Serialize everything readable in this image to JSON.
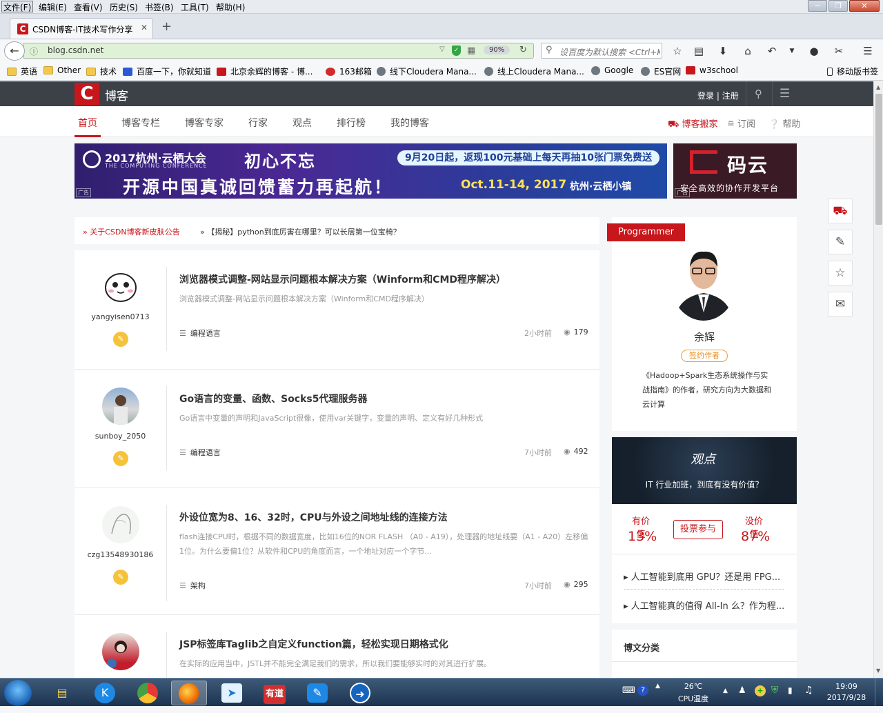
{
  "menubar": {
    "items": [
      "文件(F)",
      "编辑(E)",
      "查看(V)",
      "历史(S)",
      "书签(B)",
      "工具(T)",
      "帮助(H)"
    ]
  },
  "tab": {
    "title": "CSDN博客-IT技术写作分享",
    "favicon": "C"
  },
  "address": {
    "url": "blog.csdn.net",
    "zoom": "90%",
    "search_placeholder": "设百度为默认搜索 <Ctrl+K"
  },
  "bookmarks": [
    "英语",
    "Other",
    "技术",
    "百度一下，你就知道",
    "北京余辉的博客 - 博...",
    "163邮箱",
    "线下Cloudera Mana...",
    "线上Cloudera Mana...",
    "Google",
    "ES官网",
    "w3school",
    "移动版书签"
  ],
  "header": {
    "logo": "C",
    "brand": "博客",
    "login": "登录 | 注册"
  },
  "subnav": {
    "items": [
      "首页",
      "博客专栏",
      "博客专家",
      "行家",
      "观点",
      "排行榜",
      "我的博客"
    ],
    "right": [
      "博客搬家",
      "订阅",
      "帮助"
    ]
  },
  "banner1": {
    "event": "2017杭州·云栖大会",
    "event_en": "THE COMPUTING CONFERENCE",
    "slogan1": "初心不忘",
    "promo": "9月20日起，返现100元基础上每天再抽10张门票免费送",
    "slogan2": "开源中国真诚回馈蓄力再起航！",
    "dates": "Oct.11-14, 2017",
    "place": "杭州·云栖小镇",
    "ad": "广告"
  },
  "banner2": {
    "name": "码云",
    "slogan": "安全高效的协作开发平台",
    "ad": "广告"
  },
  "notices": [
    "» 关于CSDN博客新皮肤公告",
    "» 【揭秘】python到底厉害在哪里？可以长居第一位宝椅？"
  ],
  "articles": [
    {
      "user": "yangyisen0713",
      "title": "浏览器模式调整-网站显示问题根本解决方案（Winform和CMD程序解决）",
      "desc": "浏览器模式调整-网站显示问题根本解决方案（Winform和CMD程序解决）",
      "category": "编程语言",
      "time": "2小时前",
      "views": "179"
    },
    {
      "user": "sunboy_2050",
      "title": "Go语言的变量、函数、Socks5代理服务器",
      "desc": "Go语言中变量的声明和JavaScript很像，使用var关键字，变量的声明、定义有好几种形式",
      "category": "编程语言",
      "time": "7小时前",
      "views": "492"
    },
    {
      "user": "czg13548930186",
      "title": "外设位宽为8、16、32时，CPU与外设之间地址线的连接方法",
      "desc": "flash连接CPU时，根据不同的数据宽度，比如16位的NOR FLASH （A0 - A19），处理器的地址线要（A1 - A20）左移偏1位。为什么要偏1位？从软件和CPU的角度而言，一个地址对应一个字节...",
      "category": "架构",
      "time": "7小时前",
      "views": "295"
    },
    {
      "user": "",
      "title": "JSP标签库Taglib之自定义function篇，轻松实现日期格式化",
      "desc": "在实际的应用当中，JSTL并不能完全满足我们的需求，所以我们要能够实时的对其进行扩展。",
      "category": "",
      "time": "",
      "views": ""
    }
  ],
  "profile": {
    "label": "Programmer",
    "name": "余辉",
    "tag": "签约作者",
    "bio": "《Hadoop+Spark生态系统操作与实战指南》的作者，研究方向为大数据和云计算"
  },
  "opinion": {
    "logo": "观点",
    "question": "IT 行业加班，到底有没有价值？",
    "yes_label": "有价值",
    "yes_pct": "13%",
    "no_label": "没价值",
    "no_pct": "87%",
    "vote_btn": "投票参与",
    "links": [
      "人工智能到底用 GPU？还是用 FPG...",
      "人工智能真的值得 All-In 么？作为程..."
    ]
  },
  "category_box": {
    "title": "博文分类"
  },
  "taskbar": {
    "temp": "26℃",
    "temp_label": "CPU温度",
    "time": "19:09",
    "date": "2017/9/28"
  },
  "colors": {
    "accent": "#c8171c",
    "header": "#3c4148"
  }
}
